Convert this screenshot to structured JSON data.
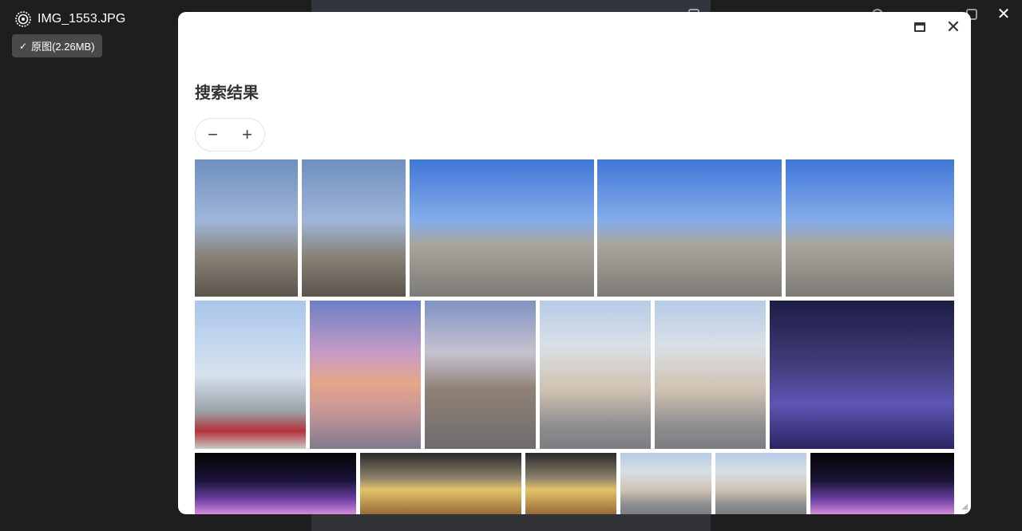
{
  "viewer": {
    "filename": "IMG_1553.JPG",
    "original_badge": "原图(2.26MB)",
    "check_glyph": "✓",
    "close_glyph": "✕"
  },
  "dialog": {
    "title": "搜索结果",
    "zoom_out_glyph": "−",
    "zoom_in_glyph": "+",
    "close_glyph": "✕"
  },
  "thumbnails": [
    {
      "scene": "sculpture-buildings-evening"
    },
    {
      "scene": "sculpture-buildings-evening"
    },
    {
      "scene": "monument-blue-sky"
    },
    {
      "scene": "monument-blue-sky"
    },
    {
      "scene": "monument-blue-sky"
    },
    {
      "scene": "skyscraper-flowers"
    },
    {
      "scene": "sunset-river-tower"
    },
    {
      "scene": "street-dusk-crowd"
    },
    {
      "scene": "apartment-flag-square"
    },
    {
      "scene": "apartment-flag-square"
    },
    {
      "scene": "mall-night-purple"
    },
    {
      "scene": "night-gate-lights"
    },
    {
      "scene": "lit-building-sign"
    },
    {
      "scene": "lit-building-sign"
    },
    {
      "scene": "apartment-flag-square"
    },
    {
      "scene": "apartment-flag-square"
    },
    {
      "scene": "night-gate-lights"
    }
  ]
}
